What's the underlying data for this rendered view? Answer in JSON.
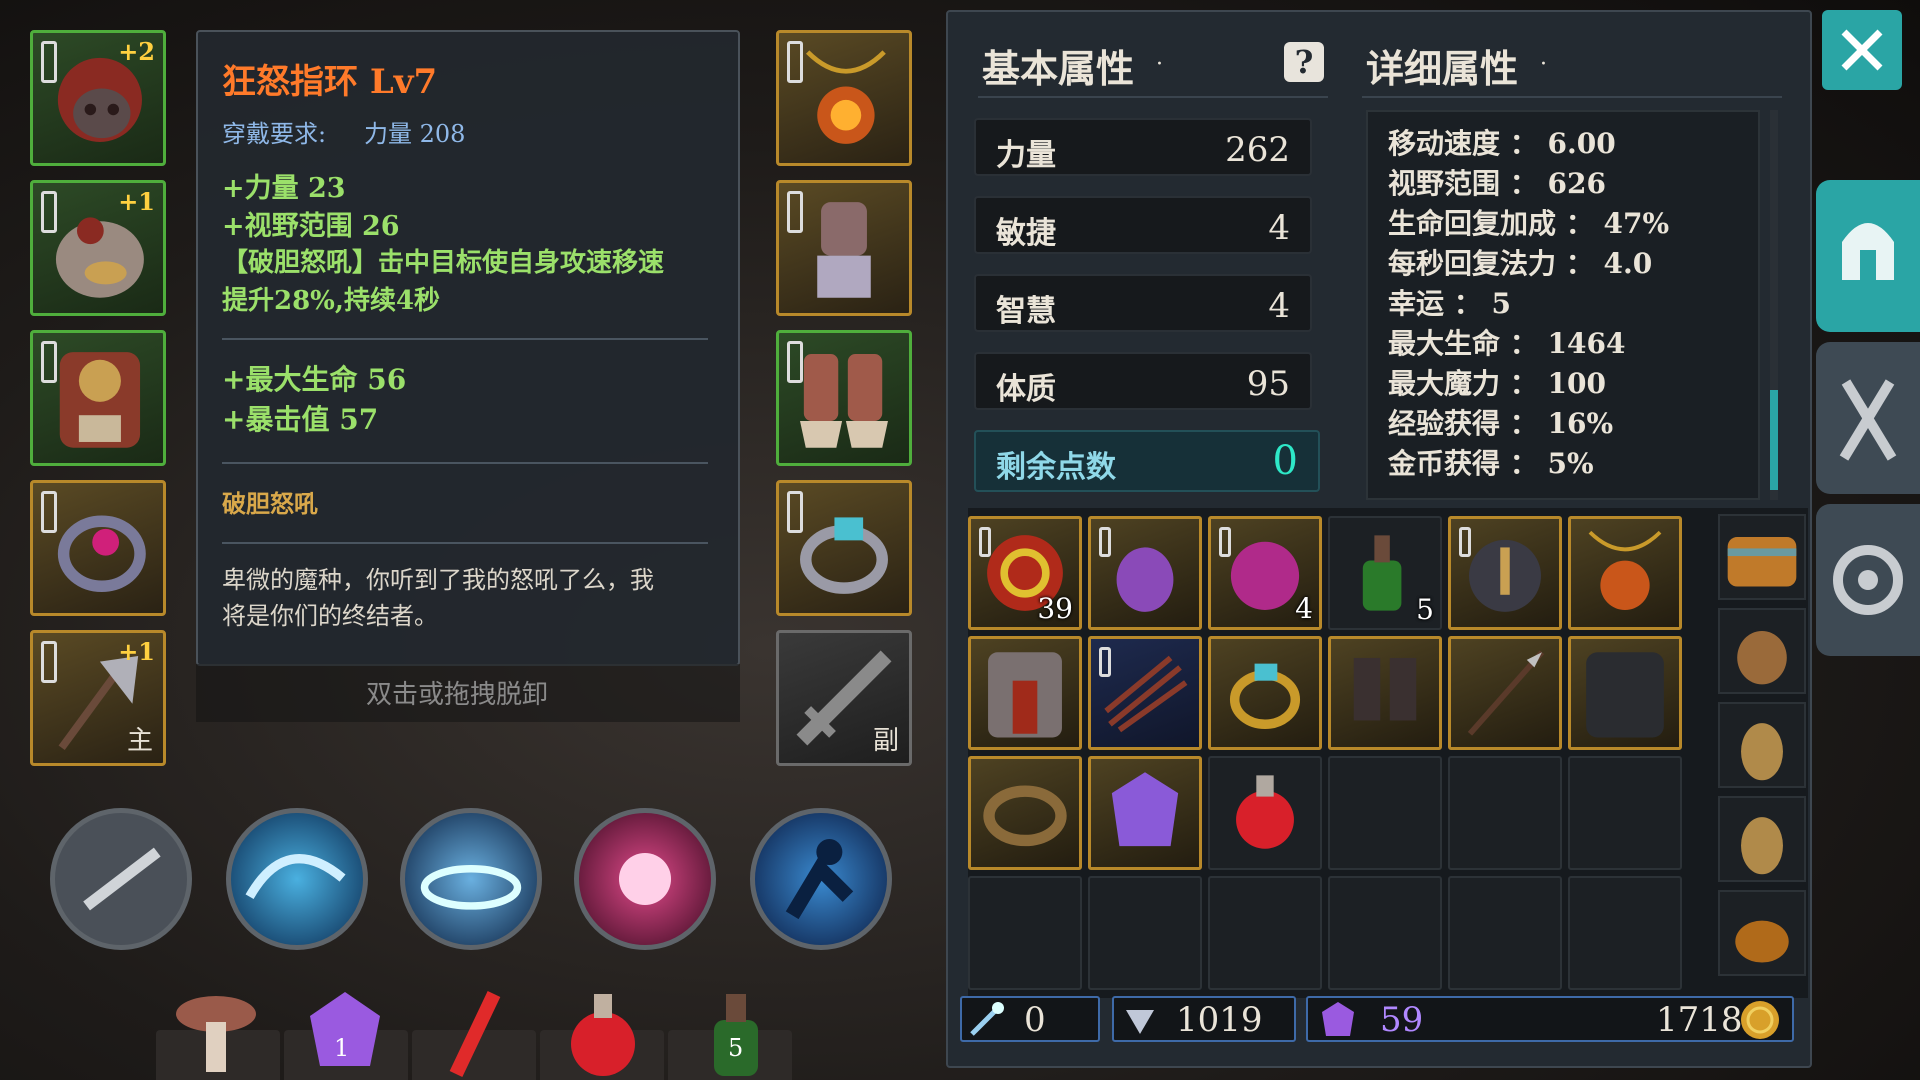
{
  "equipment": {
    "left_slots": [
      {
        "name": "helmet",
        "plus": "+2",
        "label": ""
      },
      {
        "name": "chest-armor",
        "plus": "+1",
        "label": ""
      },
      {
        "name": "leg-armor",
        "plus": "",
        "label": ""
      },
      {
        "name": "ring-left",
        "plus": "",
        "label": ""
      },
      {
        "name": "main-weapon",
        "plus": "+1",
        "label": "主"
      }
    ],
    "right_slots": [
      {
        "name": "necklace",
        "label": ""
      },
      {
        "name": "gloves",
        "label": ""
      },
      {
        "name": "boots",
        "label": ""
      },
      {
        "name": "ring-right",
        "label": ""
      },
      {
        "name": "offhand",
        "label": "副"
      }
    ]
  },
  "tooltip": {
    "title": "狂怒指环 Lv7",
    "requirement_label": "穿戴要求:",
    "requirement_value": "力量 208",
    "stat_1": "+力量 23",
    "stat_2": "+视野范围 26",
    "skill_effect_1": "【破胆怒吼】击中目标使自身攻速移速",
    "skill_effect_2": "提升28%,持续4秒",
    "stat_3": "+最大生命 56",
    "stat_4": "+暴击值 57",
    "skill_name": "破胆怒吼",
    "flavor_1": "卑微的魔种，你听到了我的怒吼了么，我",
    "flavor_2": "将是你们的终结者。",
    "hint": "双击或拖拽脱卸"
  },
  "consumables": [
    {
      "name": "mushroom",
      "count": ""
    },
    {
      "name": "purple-gem",
      "count": "1"
    },
    {
      "name": "red-vial",
      "count": ""
    },
    {
      "name": "health-potion",
      "count": ""
    },
    {
      "name": "green-potion",
      "count": "5"
    }
  ],
  "basic": {
    "title": "基本属性",
    "stats": [
      {
        "name": "力量",
        "value": "262"
      },
      {
        "name": "敏捷",
        "value": "4"
      },
      {
        "name": "智慧",
        "value": "4"
      },
      {
        "name": "体质",
        "value": "95"
      }
    ],
    "remaining_label": "剩余点数",
    "remaining_value": "0"
  },
  "detailed": {
    "title": "详细属性",
    "stats": [
      "移动速度 ： 6.00",
      "视野范围 ： 626",
      "生命回复加成 ： 47%",
      "每秒回复法力 ： 4.0",
      "幸运 ： 5",
      "最大生命 ： 1464",
      "最大魔力 ： 100",
      "经验获得 ： 16%",
      "金币获得 ： 5%"
    ]
  },
  "inventory_counts": {
    "swirl": "39",
    "demon": "4",
    "green_potion": "5"
  },
  "currency": {
    "crystal": "0",
    "souls": "1019",
    "gems": "59",
    "gold": "1718"
  },
  "colors": {
    "title": "#ff7a2a",
    "stat_green": "#9be06a",
    "requirement": "#8fb8e8",
    "skill_label": "#d9a84a",
    "remaining": "#2ee8c8",
    "accent_tab": "#2aa5a5"
  }
}
